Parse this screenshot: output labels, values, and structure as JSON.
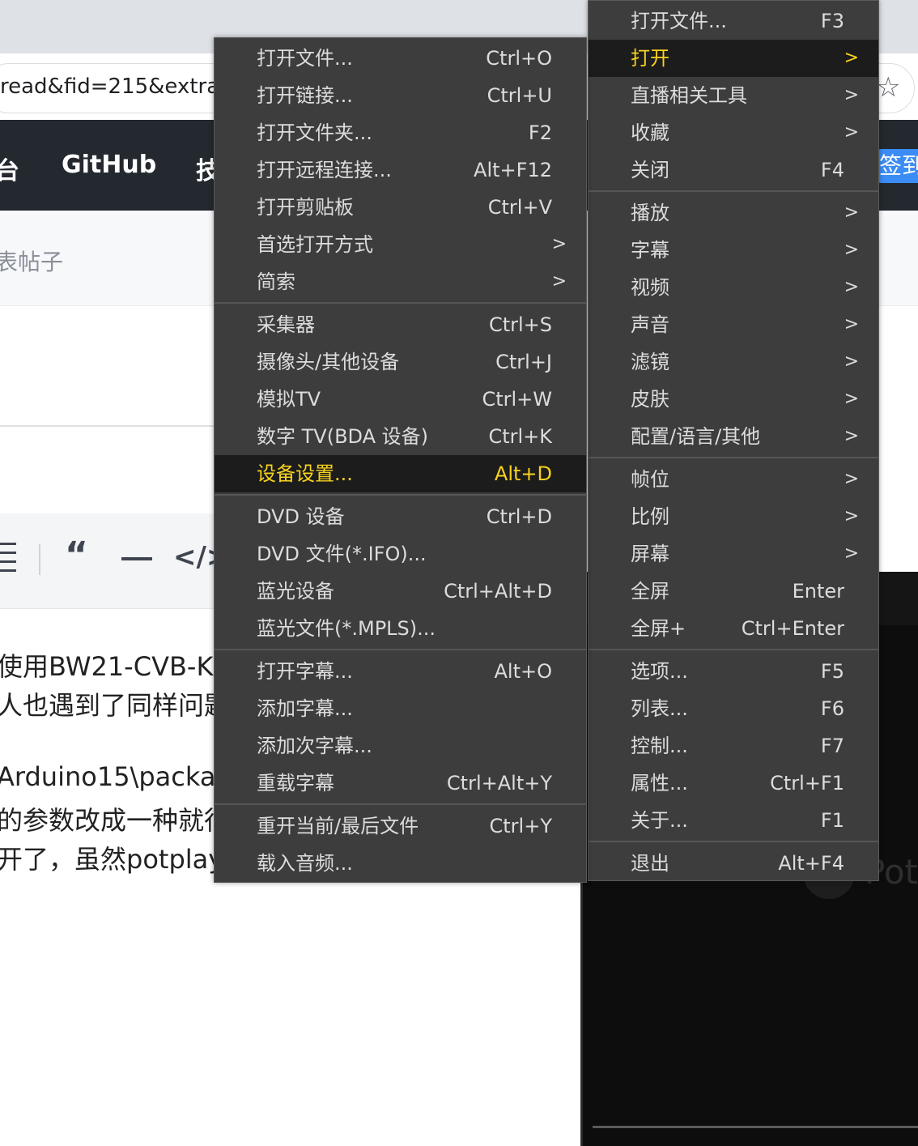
{
  "browser": {
    "url_fragment": "read&fid=215&extra=",
    "nav": {
      "item_partial_left": "台",
      "github": "GitHub",
      "item_partial_right": "技",
      "signin_button": "签到"
    },
    "subbar_text": "表帖子",
    "post_lines": [
      "使用BW21-CVB-K",
      "人也遇到了同样问题",
      "Arduino15\\packa",
      "的参数改成一种就行",
      "开了，虽然potplay"
    ],
    "player_watermark": "Pot"
  },
  "main_menu": {
    "items": [
      {
        "label": "打开文件...",
        "shortcut": "F3"
      },
      {
        "label": "打开",
        "arrow": ">",
        "highlighted": true
      },
      {
        "label": "直播相关工具",
        "arrow": ">"
      },
      {
        "label": "收藏",
        "arrow": ">"
      },
      {
        "label": "关闭",
        "shortcut": "F4"
      },
      {
        "label": "播放",
        "arrow": ">"
      },
      {
        "label": "字幕",
        "arrow": ">"
      },
      {
        "label": "视频",
        "arrow": ">"
      },
      {
        "label": "声音",
        "arrow": ">"
      },
      {
        "label": "滤镜",
        "arrow": ">"
      },
      {
        "label": "皮肤",
        "arrow": ">"
      },
      {
        "label": "配置/语言/其他",
        "arrow": ">"
      },
      {
        "label": "帧位",
        "arrow": ">"
      },
      {
        "label": "比例",
        "arrow": ">"
      },
      {
        "label": "屏幕",
        "arrow": ">"
      },
      {
        "label": "全屏",
        "shortcut": "Enter"
      },
      {
        "label": "全屏+",
        "shortcut": "Ctrl+Enter"
      },
      {
        "label": "选项...",
        "shortcut": "F5"
      },
      {
        "label": "列表...",
        "shortcut": "F6"
      },
      {
        "label": "控制...",
        "shortcut": "F7"
      },
      {
        "label": "属性...",
        "shortcut": "Ctrl+F1"
      },
      {
        "label": "关于...",
        "shortcut": "F1"
      },
      {
        "label": "退出",
        "shortcut": "Alt+F4"
      }
    ]
  },
  "open_submenu": {
    "items": [
      {
        "label": "打开文件...",
        "shortcut": "Ctrl+O"
      },
      {
        "label": "打开链接...",
        "shortcut": "Ctrl+U"
      },
      {
        "label": "打开文件夹...",
        "shortcut": "F2"
      },
      {
        "label": "打开远程连接...",
        "shortcut": "Alt+F12"
      },
      {
        "label": "打开剪贴板",
        "shortcut": "Ctrl+V"
      },
      {
        "label": "首选打开方式",
        "arrow": ">"
      },
      {
        "label": "简索",
        "arrow": ">"
      },
      {
        "label": "采集器",
        "shortcut": "Ctrl+S"
      },
      {
        "label": "摄像头/其他设备",
        "shortcut": "Ctrl+J"
      },
      {
        "label": "模拟TV",
        "shortcut": "Ctrl+W"
      },
      {
        "label": "数字 TV(BDA 设备)",
        "shortcut": "Ctrl+K"
      },
      {
        "label": "设备设置...",
        "shortcut": "Alt+D",
        "highlighted": true
      },
      {
        "label": "DVD 设备",
        "shortcut": "Ctrl+D"
      },
      {
        "label": "DVD 文件(*.IFO)...",
        "shortcut": ""
      },
      {
        "label": "蓝光设备",
        "shortcut": "Ctrl+Alt+D"
      },
      {
        "label": "蓝光文件(*.MPLS)...",
        "shortcut": ""
      },
      {
        "label": "打开字幕...",
        "shortcut": "Alt+O"
      },
      {
        "label": "添加字幕...",
        "shortcut": ""
      },
      {
        "label": "添加次字幕...",
        "shortcut": ""
      },
      {
        "label": "重载字幕",
        "shortcut": "Ctrl+Alt+Y"
      },
      {
        "label": "重开当前/最后文件",
        "shortcut": "Ctrl+Y"
      },
      {
        "label": "载入音频...",
        "shortcut": ""
      }
    ]
  }
}
